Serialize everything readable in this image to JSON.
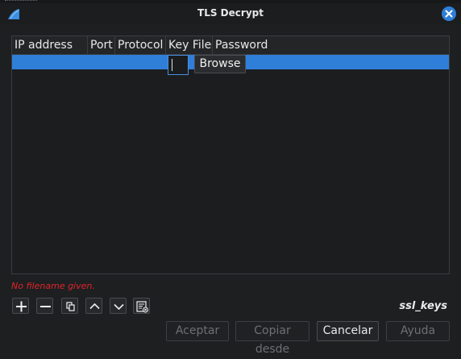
{
  "window": {
    "title": "TLS Decrypt"
  },
  "table": {
    "columns": [
      "IP address",
      "Port",
      "Protocol",
      "Key File",
      "Password"
    ],
    "editor": {
      "browse_label": "Browse"
    }
  },
  "error_message": "No filename given.",
  "toolbar": {
    "add": "plus-icon",
    "remove": "minus-icon",
    "copy": "copy-icon",
    "move_up": "chevron-up-icon",
    "move_down": "chevron-down-icon",
    "clear": "clear-list-icon"
  },
  "uat_name": "ssl_keys",
  "buttons": {
    "ok": "Aceptar",
    "copy_from": "Copiar desde",
    "cancel": "Cancelar",
    "help": "Ayuda"
  },
  "colors": {
    "selection": "#2f7fd9",
    "error": "#e0242a",
    "close": "#2d7fd6"
  }
}
